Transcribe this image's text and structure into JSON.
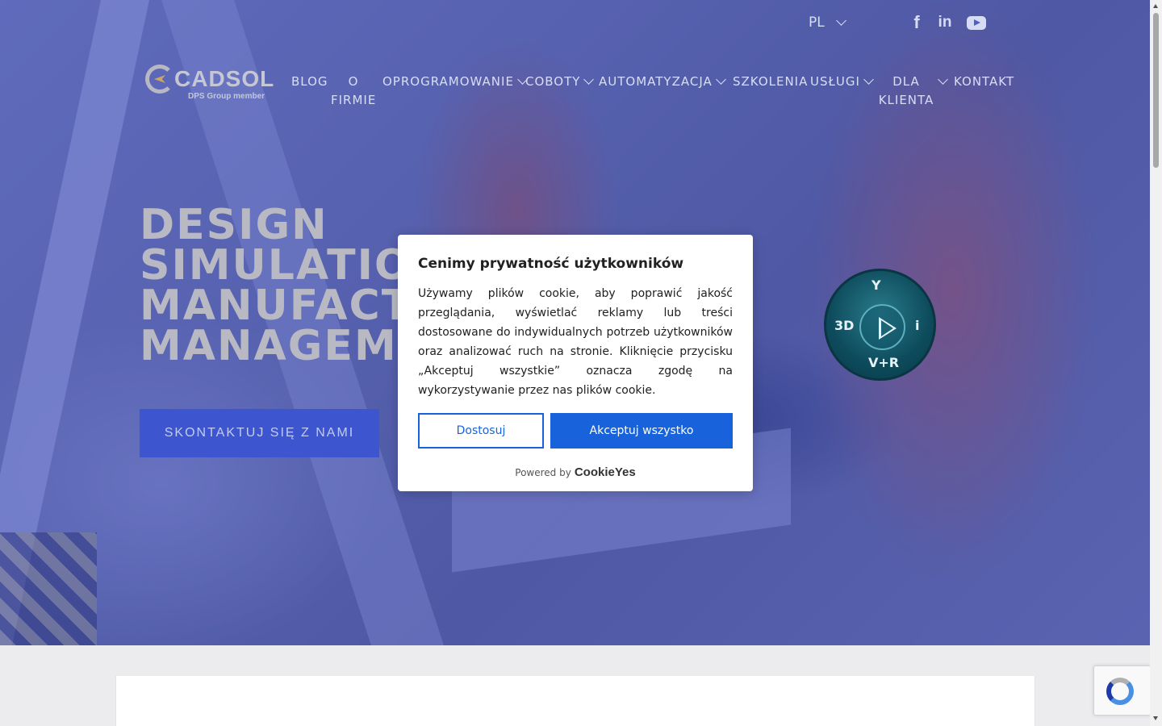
{
  "header": {
    "language": "PL",
    "social": [
      "facebook-icon",
      "linkedin-icon",
      "youtube-icon"
    ],
    "logo": {
      "name": "CADSOL",
      "tagline": "DPS Group member"
    }
  },
  "nav": {
    "blog": "BLOG",
    "o_firmie_1": "O",
    "o_firmie_2": "FIRMIE",
    "oprogramowanie": "OPROGRAMOWANIE",
    "coboty": "COBOTY",
    "automatyzacja": "AUTOMATYZACJA",
    "szkolenia": "SZKOLENIA",
    "uslugi": "USŁUGI",
    "dla_klienta_1": "DLA",
    "dla_klienta_2": "KLIENTA",
    "kontakt": "KONTAKT"
  },
  "hero": {
    "line1": "DESIGN",
    "line2": "SIMULATIO",
    "line3": "MANUFACT",
    "line4": "MANAGEMI",
    "cta": "SKONTAKTUJ SIĘ Z NAMI",
    "badge": {
      "top": "Y",
      "left": "3D",
      "right": "i",
      "bottom": "V+R"
    }
  },
  "cookie": {
    "title": "Cenimy prywatność użytkowników",
    "body": "Używamy plików cookie, aby poprawić jakość przeglądania, wyświetlać reklamy lub treści dostosowane do indywidualnych potrzeb użytkowników oraz analizować ruch na stronie. Kliknięcie przycisku „Akceptuj wszystkie” oznacza zgodę na wykorzystywanie przez nas plików cookie.",
    "customize": "Dostosuj",
    "accept": "Akceptuj wszystko",
    "powered_by": "Powered by",
    "brand": "CookieYes"
  },
  "colors": {
    "accent": "#1863dc",
    "hero_overlay": "#3c4bbe",
    "cta_bg": "#3d56cf"
  }
}
